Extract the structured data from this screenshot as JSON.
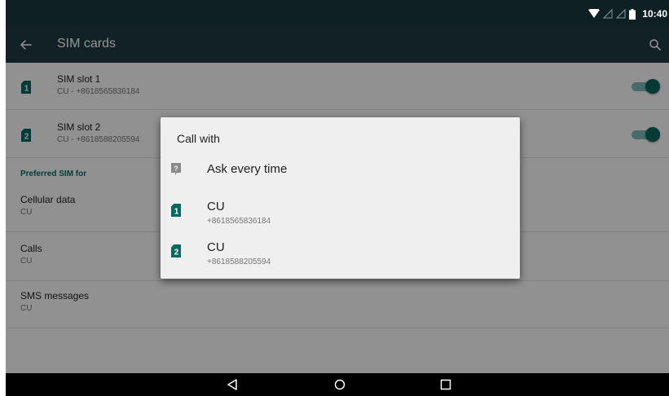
{
  "status_bar": {
    "time": "10:40",
    "icons": [
      "wifi-icon",
      "signal-icon",
      "signal-icon",
      "battery-icon"
    ]
  },
  "app_bar": {
    "title": "SIM cards",
    "back_icon": "arrow-left-icon",
    "search_icon": "search-icon"
  },
  "sim_slots": [
    {
      "title": "SIM slot 1",
      "subtitle": "CU - +8618565836184",
      "badge": "1",
      "enabled": true
    },
    {
      "title": "SIM slot 2",
      "subtitle": "CU - +8618588205594",
      "badge": "2",
      "enabled": true
    }
  ],
  "preferred": {
    "header": "Preferred SIM for",
    "items": [
      {
        "title": "Cellular data",
        "subtitle": "CU"
      },
      {
        "title": "Calls",
        "subtitle": "CU"
      },
      {
        "title": "SMS messages",
        "subtitle": "CU"
      }
    ]
  },
  "dialog": {
    "title": "Call with",
    "options": [
      {
        "label": "Ask every time",
        "subtitle": "",
        "icon": "question-icon"
      },
      {
        "label": "CU",
        "subtitle": "+8618565836184",
        "icon": "sim-1-icon",
        "badge": "1"
      },
      {
        "label": "CU",
        "subtitle": "+8618588205594",
        "icon": "sim-2-icon",
        "badge": "2"
      }
    ]
  },
  "nav_bar": {
    "buttons": [
      "back-triangle-icon",
      "home-circle-icon",
      "recents-square-icon"
    ]
  },
  "colors": {
    "status_bar": "#0f2025",
    "app_bar": "#1f3a41",
    "accent": "#08675f",
    "toggle_track": "#7fb8b7",
    "dialog_bg": "#efefef",
    "scrim": "rgba(0,0,0,0.42)"
  }
}
